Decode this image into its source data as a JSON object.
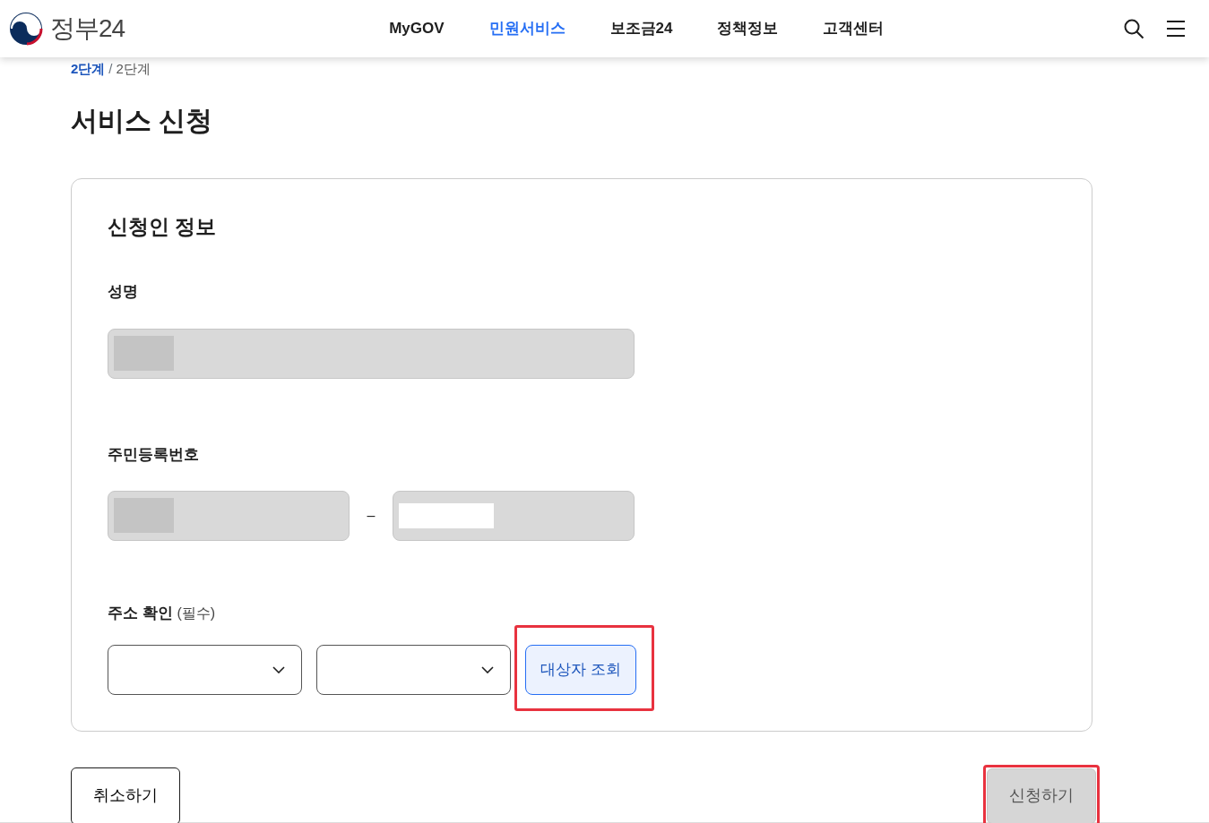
{
  "header": {
    "logo_text": "정부24",
    "nav": [
      {
        "label": "MyGOV",
        "selected": false
      },
      {
        "label": "민원서비스",
        "selected": true
      },
      {
        "label": "보조금24",
        "selected": false
      },
      {
        "label": "정책정보",
        "selected": false
      },
      {
        "label": "고객센터",
        "selected": false
      }
    ]
  },
  "breadcrumb_separator": "/",
  "breadcrumb": [
    {
      "label": "2단계",
      "kind": "link"
    },
    {
      "label": "2단계",
      "kind": "current"
    }
  ],
  "page_title": "서비스 신청",
  "form": {
    "title": "신청인 정보",
    "name_field": {
      "label": "성명",
      "disabled": true,
      "redaction": {
        "color": "#c4c4c4"
      }
    },
    "id_field": {
      "label": "주민등록번호",
      "separator": "–",
      "parts": [
        {
          "disabled": true,
          "redaction": {
            "color": "#c4c4c4"
          }
        },
        {
          "disabled": true,
          "redaction": {
            "color": "#ffffff"
          }
        }
      ]
    },
    "address": {
      "label": "주소 확인",
      "note": "(필수)",
      "selects": [
        {
          "disabled": false
        },
        {
          "disabled": false
        }
      ],
      "lookup_button": {
        "label": "대상자 조회",
        "highlighted": true
      }
    }
  },
  "actions": {
    "cancel": {
      "label": "취소하기"
    },
    "submit": {
      "label": "신청하기",
      "disabled": true,
      "highlighted": true
    }
  }
}
